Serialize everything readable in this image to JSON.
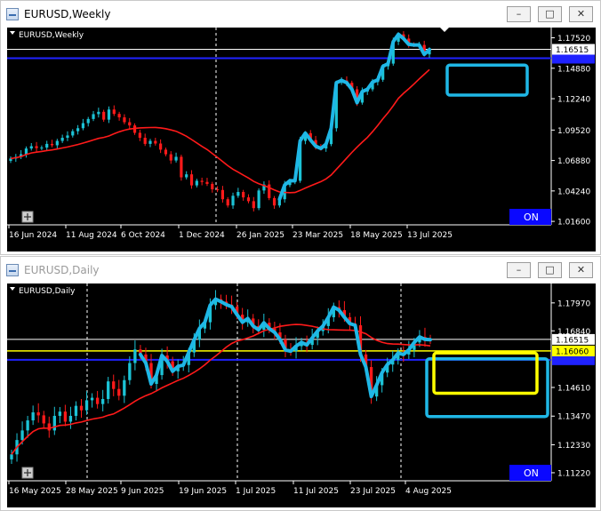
{
  "windows": [
    {
      "title": "EURUSD,Weekly",
      "active": true,
      "chart_label": "EURUSD,Weekly",
      "status_label": "ON",
      "controls": {
        "minimize": "–",
        "maximize": "□",
        "close": "✕"
      },
      "chart_data": {
        "type": "candlestick",
        "symbol": "EURUSD",
        "timeframe": "Weekly",
        "x_labels": [
          "16 Jun 2024",
          "11 Aug 2024",
          "6 Oct 2024",
          "1 Dec 2024",
          "26 Jan 2025",
          "23 Mar 2025",
          "18 May 2025",
          "13 Jul 2025"
        ],
        "y_ticks": [
          1.1752,
          1.1488,
          1.1224,
          1.0952,
          1.0688,
          1.0424,
          1.016
        ],
        "y_tick_labels": [
          "1.17520",
          "1.14880",
          "1.12240",
          "1.09520",
          "1.06880",
          "1.04240",
          "1.01600"
        ],
        "ylim": [
          1.013,
          1.181
        ],
        "current_price": "1.16515",
        "lines": {
          "white_level": 1.1652,
          "blue_level": 1.1575
        },
        "close": [
          1.0705,
          1.0718,
          1.0742,
          1.0792,
          1.0812,
          1.0795,
          1.08,
          1.0832,
          1.082,
          1.0858,
          1.0885,
          1.0905,
          1.0942,
          1.0968,
          1.1012,
          1.1048,
          1.109,
          1.111,
          1.1042,
          1.113,
          1.1092,
          1.1062,
          1.102,
          1.0992,
          1.0928,
          1.0885,
          1.0832,
          1.0858,
          1.0835,
          1.0782,
          1.0742,
          1.0688,
          1.072,
          1.0542,
          1.0568,
          1.0472,
          1.0512,
          1.0502,
          1.0485,
          1.0438,
          1.0432,
          1.0352,
          1.0298,
          1.0382,
          1.0415,
          1.0368,
          1.0335,
          1.0275,
          1.0428,
          1.048,
          1.0362,
          1.0298,
          1.0352,
          1.0475,
          1.0512,
          1.0512,
          1.0858,
          1.0925,
          1.0865,
          1.0812,
          1.0792,
          1.083,
          1.0968,
          1.1362,
          1.1382,
          1.1362,
          1.1305,
          1.119,
          1.1285,
          1.1305,
          1.1368,
          1.1388,
          1.1505,
          1.1528,
          1.1718,
          1.1782,
          1.1745,
          1.1695,
          1.169,
          1.169,
          1.1608,
          1.165
        ]
      }
    },
    {
      "title": "EURUSD,Daily",
      "active": false,
      "chart_label": "EURUSD,Daily",
      "status_label": "ON",
      "controls": {
        "minimize": "–",
        "maximize": "□",
        "close": "✕"
      },
      "chart_data": {
        "type": "candlestick",
        "symbol": "EURUSD",
        "timeframe": "Daily",
        "x_labels": [
          "16 May 2025",
          "28 May 2025",
          "9 Jun 2025",
          "19 Jun 2025",
          "1 Jul 2025",
          "11 Jul 2025",
          "23 Jul 2025",
          "4 Aug 2025"
        ],
        "y_ticks": [
          1.1797,
          1.1686,
          1.1461,
          1.1347,
          1.1233,
          1.1122
        ],
        "y_tick_labels": [
          "1.17970",
          "1.16840",
          "1.14610",
          "1.13470",
          "1.12330",
          "1.11220"
        ],
        "ylim": [
          1.109,
          1.186
        ],
        "current_price": "1.16515",
        "yellow_price": "1.16060",
        "lines": {
          "white_level": 1.1652,
          "yellow_level": 1.1606,
          "blue_level": 1.1571
        },
        "close": [
          1.1195,
          1.1252,
          1.129,
          1.133,
          1.1362,
          1.135,
          1.1318,
          1.129,
          1.1348,
          1.1365,
          1.1325,
          1.1348,
          1.1388,
          1.137,
          1.141,
          1.142,
          1.1395,
          1.1415,
          1.1485,
          1.1455,
          1.1428,
          1.149,
          1.1558,
          1.1612,
          1.1592,
          1.1558,
          1.1475,
          1.151,
          1.1588,
          1.1565,
          1.1525,
          1.1545,
          1.155,
          1.16,
          1.165,
          1.1695,
          1.172,
          1.1788,
          1.1812,
          1.1802,
          1.179,
          1.1782,
          1.175,
          1.172,
          1.1735,
          1.1705,
          1.169,
          1.1718,
          1.1695,
          1.168,
          1.1652,
          1.161,
          1.1605,
          1.1625,
          1.164,
          1.163,
          1.1658,
          1.1685,
          1.1705,
          1.174,
          1.178,
          1.1768,
          1.174,
          1.1715,
          1.1708,
          1.1592,
          1.1542,
          1.1425,
          1.147,
          1.152,
          1.1552,
          1.157,
          1.1598,
          1.1592,
          1.161,
          1.164,
          1.1662,
          1.1652,
          1.1651
        ]
      }
    }
  ]
}
